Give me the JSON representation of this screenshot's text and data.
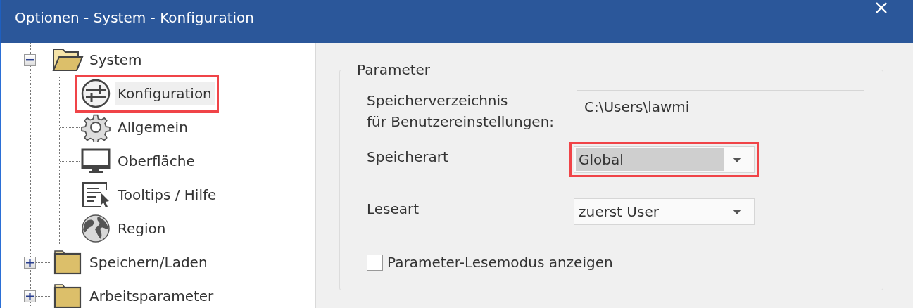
{
  "window": {
    "title": "Optionen - System - Konfiguration"
  },
  "tree": [
    {
      "label": "System",
      "expanded": true,
      "children": [
        {
          "label": "Konfiguration",
          "kind": "sliders",
          "selected": true,
          "highlighted": true
        },
        {
          "label": "Allgemein",
          "kind": "gear",
          "selected": false,
          "highlighted": false
        },
        {
          "label": "Oberfläche",
          "kind": "monitor",
          "selected": false,
          "highlighted": false
        },
        {
          "label": "Tooltips / Hilfe",
          "kind": "tooltip",
          "selected": false,
          "highlighted": false
        },
        {
          "label": "Region",
          "kind": "globe",
          "selected": false,
          "highlighted": false
        }
      ]
    },
    {
      "label": "Speichern/Laden",
      "expanded": false
    },
    {
      "label": "Arbeitsparameter",
      "expanded": false
    }
  ],
  "group": {
    "title": "Parameter",
    "fields": [
      {
        "kind": "text",
        "label": "Speicherverzeichnis\nfür Benutzereinstellungen:",
        "value": "C:\\Users\\lawmi"
      },
      {
        "kind": "combo",
        "label": "Speicherart",
        "value": "Global",
        "focused": true,
        "highlighted": true
      },
      {
        "kind": "combo",
        "label": "Leseart",
        "value": "zuerst User",
        "focused": false,
        "highlighted": false
      }
    ],
    "checkbox": {
      "label": "Parameter-Lesemodus anzeigen",
      "checked": false
    }
  }
}
